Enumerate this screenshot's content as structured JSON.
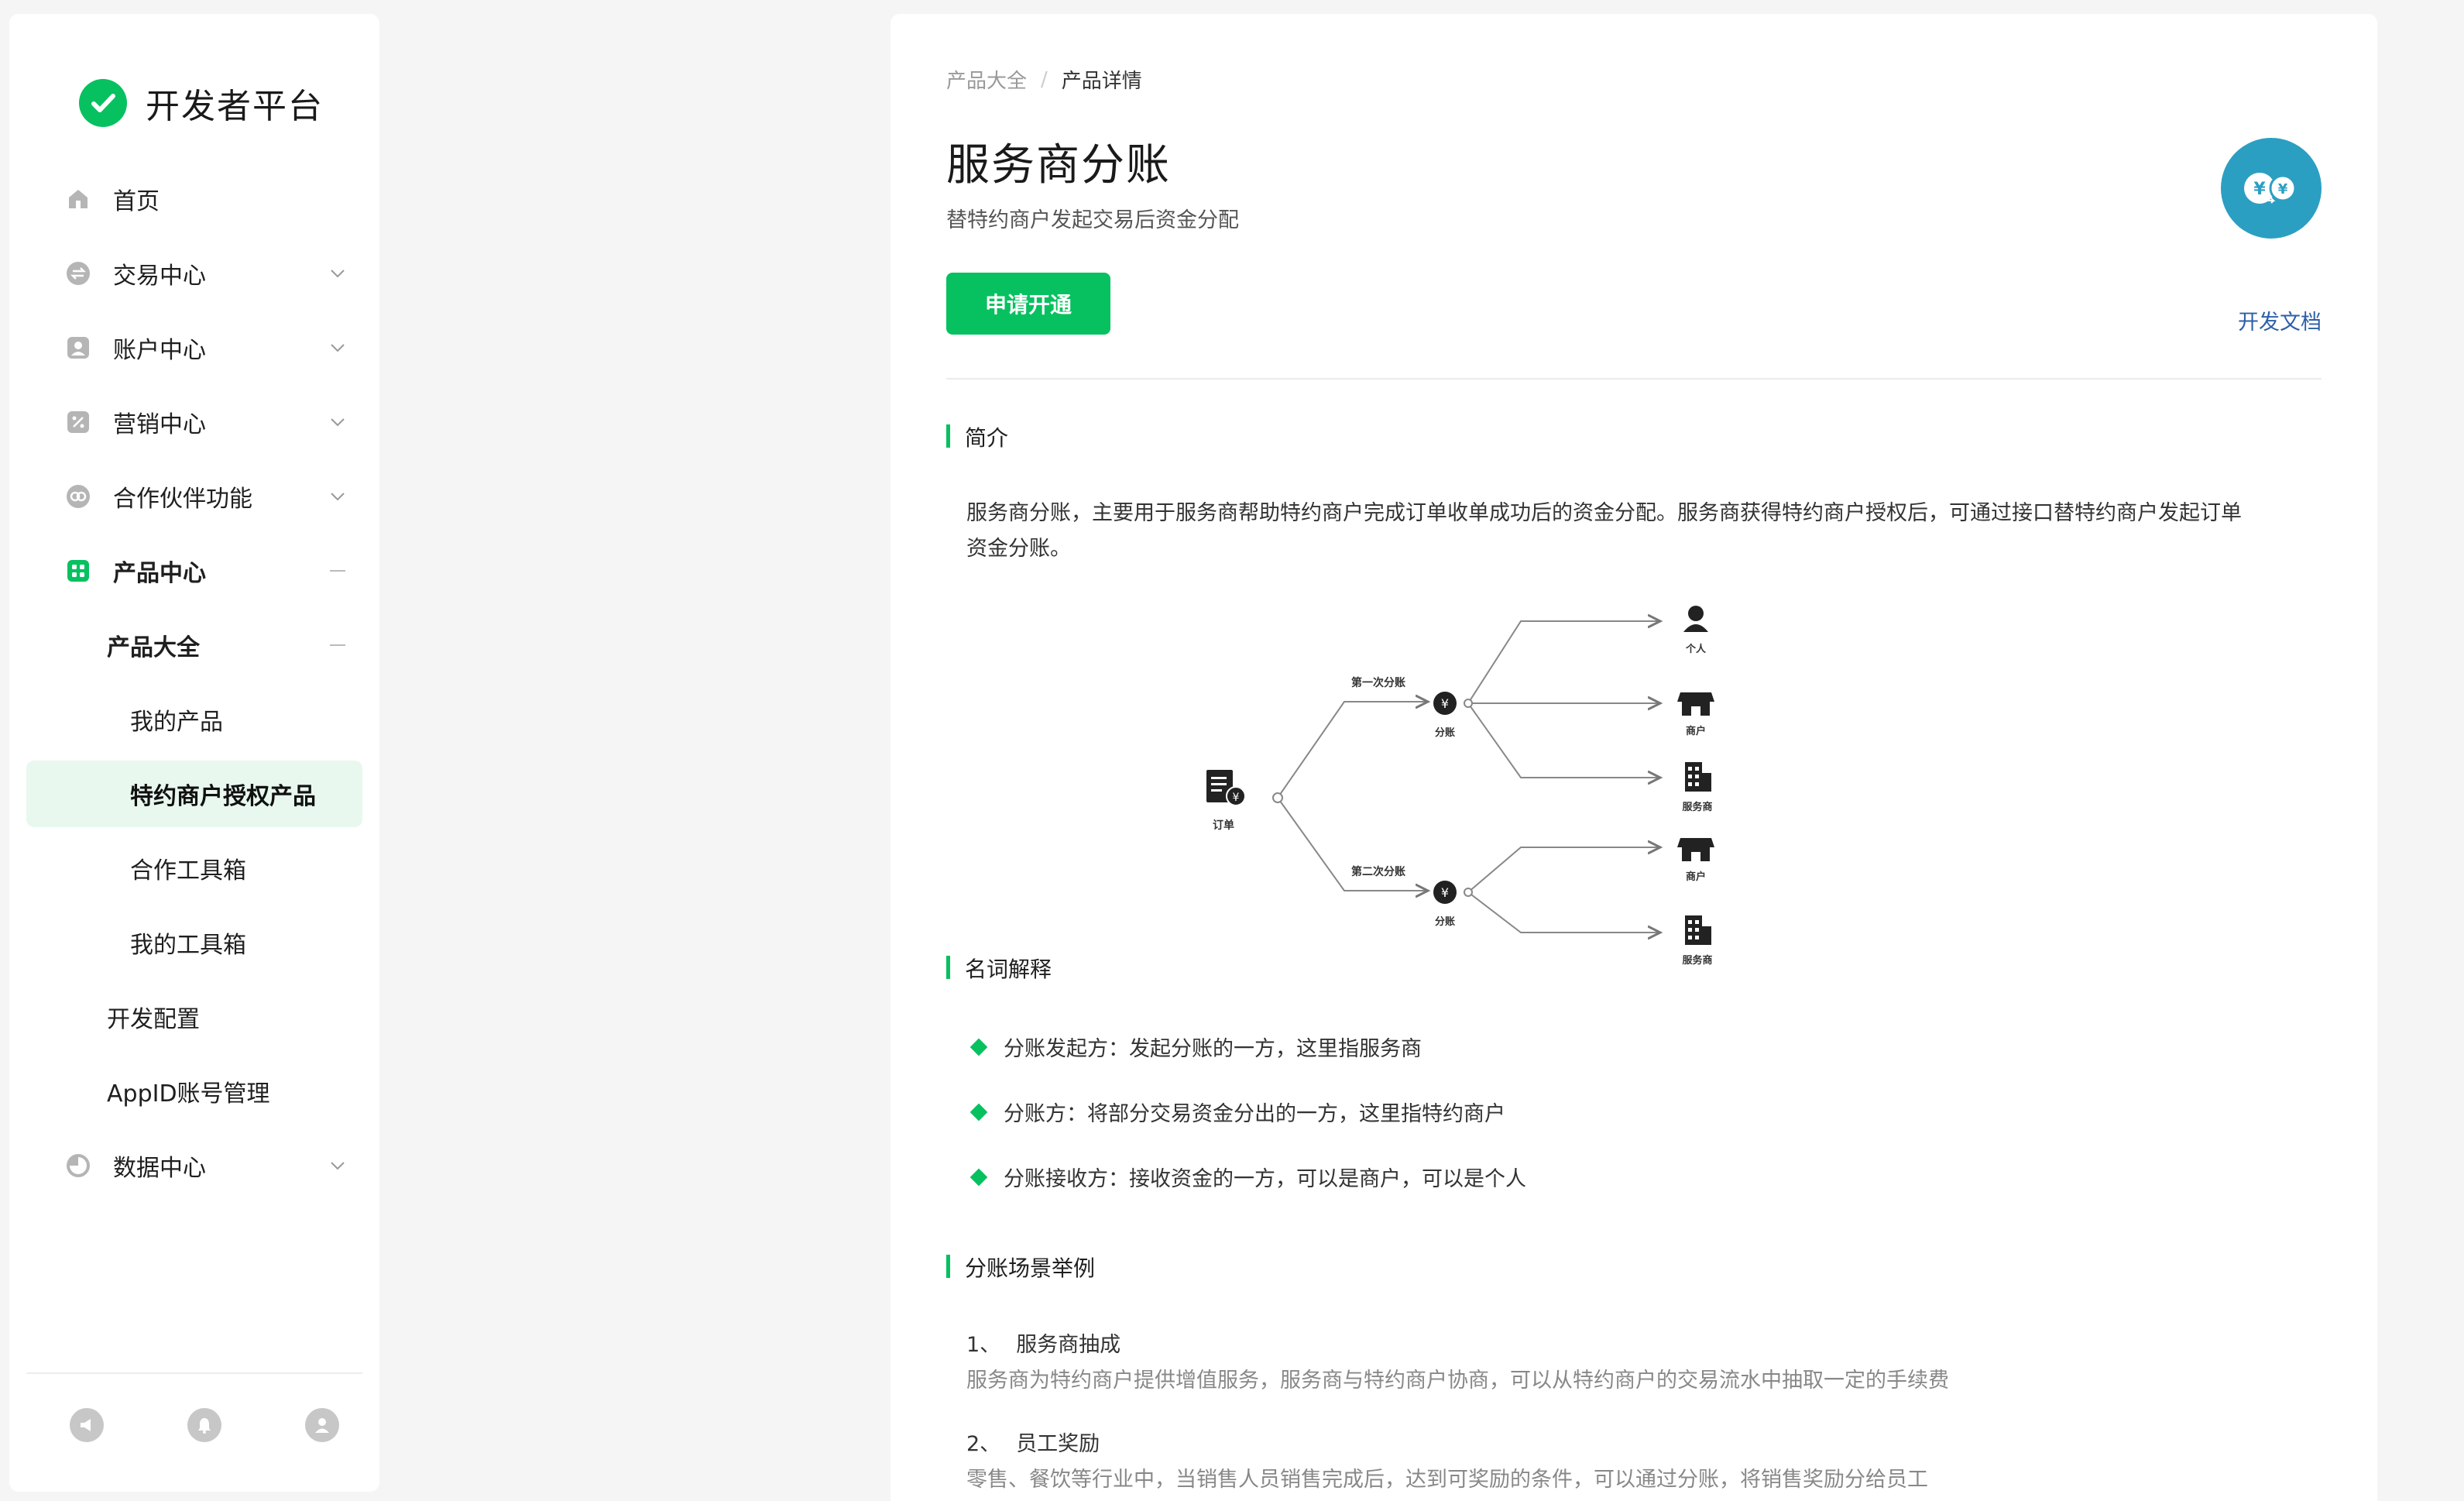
{
  "brand": {
    "name": "开发者平台"
  },
  "sidebar": {
    "items": [
      {
        "label": "首页",
        "icon": "home-icon"
      },
      {
        "label": "交易中心",
        "icon": "exchange-icon"
      },
      {
        "label": "账户中心",
        "icon": "account-icon"
      },
      {
        "label": "营销中心",
        "icon": "marketing-icon"
      },
      {
        "label": "合作伙伴功能",
        "icon": "partner-icon"
      },
      {
        "label": "产品中心",
        "icon": "product-icon"
      },
      {
        "label": "产品大全"
      },
      {
        "label": "我的产品"
      },
      {
        "label": "特约商户授权产品"
      },
      {
        "label": "合作工具箱"
      },
      {
        "label": "我的工具箱"
      },
      {
        "label": "开发配置"
      },
      {
        "label": "AppID账号管理"
      },
      {
        "label": "数据中心",
        "icon": "data-icon"
      }
    ],
    "footer_icons": [
      "announcement-icon",
      "notification-icon",
      "user-icon"
    ]
  },
  "breadcrumb": {
    "parent": "产品大全",
    "separator": "/",
    "current": "产品详情"
  },
  "product": {
    "title": "服务商分账",
    "subtitle": "替特约商户发起交易后资金分配",
    "apply_label": "申请开通",
    "doc_label": "开发文档"
  },
  "intro": {
    "title": "简介",
    "line1": "服务商分账，主要用于服务商帮助特约商户完成订单收单成功后的资金分配。服务商获得特约商户授权后，可通过接口替特约商户发起订单",
    "line2": "资金分账。"
  },
  "diagram": {
    "order": "订单",
    "first_split": "第一次分账",
    "second_split": "第二次分账",
    "split": "分账",
    "person": "个人",
    "merchant": "商户",
    "provider": "服务商"
  },
  "terms": {
    "title": "名词解释",
    "items": [
      {
        "name": "分账发起方",
        "desc": "：发起分账的一方，这里指服务商"
      },
      {
        "name": "分账方",
        "desc": "：将部分交易资金分出的一方，这里指特约商户"
      },
      {
        "name": "分账接收方",
        "desc": "：接收资金的一方，可以是商户，可以是个人"
      }
    ]
  },
  "scenarios": {
    "title": "分账场景举例",
    "items": [
      {
        "num": "1、",
        "title": "服务商抽成",
        "desc": "服务商为特约商户提供增值服务，服务商与特约商户协商，可以从特约商户的交易流水中抽取一定的手续费"
      },
      {
        "num": "2、",
        "title": "员工奖励",
        "desc": "零售、餐饮等行业中，当销售人员销售完成后，达到可奖励的条件，可以通过分账，将销售奖励分给员工"
      }
    ]
  },
  "colors": {
    "brand_green": "#07c160",
    "active_bg": "#e8f8ee",
    "link_blue": "#2d5fa8",
    "logo_teal": "#2b9fc2"
  }
}
